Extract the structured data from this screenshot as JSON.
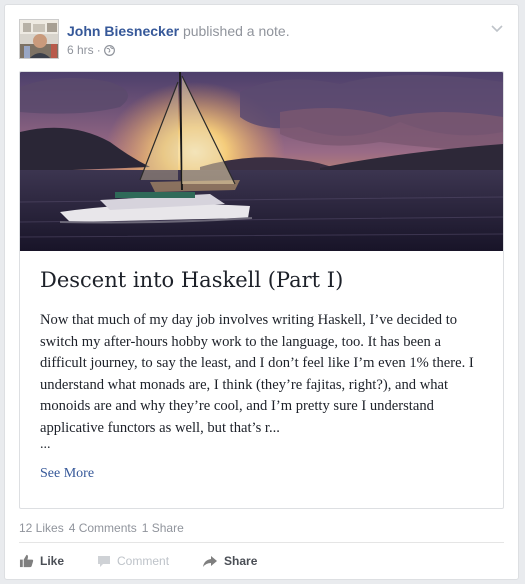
{
  "post": {
    "author": "John Biesnecker",
    "action_text": " published a note.",
    "time": "6 hrs",
    "separator": "·",
    "privacy_icon": "globe-icon",
    "menu_icon": "chevron-down-icon"
  },
  "note": {
    "title": "Descent into Haskell (Part I)",
    "body": "Now that much of my day job involves writing Haskell, I’ve decided to switch my after-hours hobby work to the language, too. It has been a difficult journey, to say the least, and I don’t feel like I’m even 1% there. I understand what monads are, I think (they’re fajitas, right?), and what monoids are and why they’re cool, and I’m pretty sure I understand applicative functors as well, but that’s r...",
    "ellipsis": "...",
    "see_more": "See More"
  },
  "stats": {
    "likes": "12 Likes",
    "comments": "4 Comments",
    "shares": "1 Share"
  },
  "actions": {
    "like": "Like",
    "comment": "Comment",
    "share": "Share"
  },
  "colors": {
    "link": "#365899",
    "muted": "#90949c",
    "background": "#e9ebee"
  }
}
